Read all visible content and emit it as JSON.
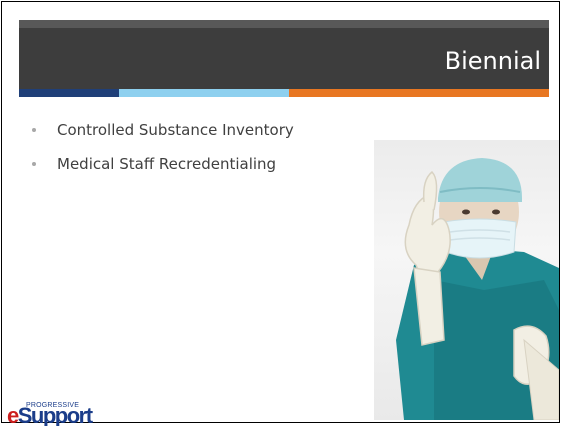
{
  "slide": {
    "title": "Biennial",
    "bullets": [
      "Controlled Substance Inventory",
      "Medical Staff Recredentialing"
    ]
  },
  "logo": {
    "small_text": "PROGRESSIVE",
    "letter_e": "e",
    "main_text": "Support"
  },
  "colors": {
    "header_dark": "#3d3d3d",
    "header_top_band": "#585858",
    "stripe_navy": "#1f3f78",
    "stripe_light_blue": "#8ed0ef",
    "stripe_orange": "#e87722",
    "scrubs_teal": "#1f8a92",
    "glove": "#f2efe4"
  },
  "icons": [
    "photo-surgeon-with-glove"
  ]
}
